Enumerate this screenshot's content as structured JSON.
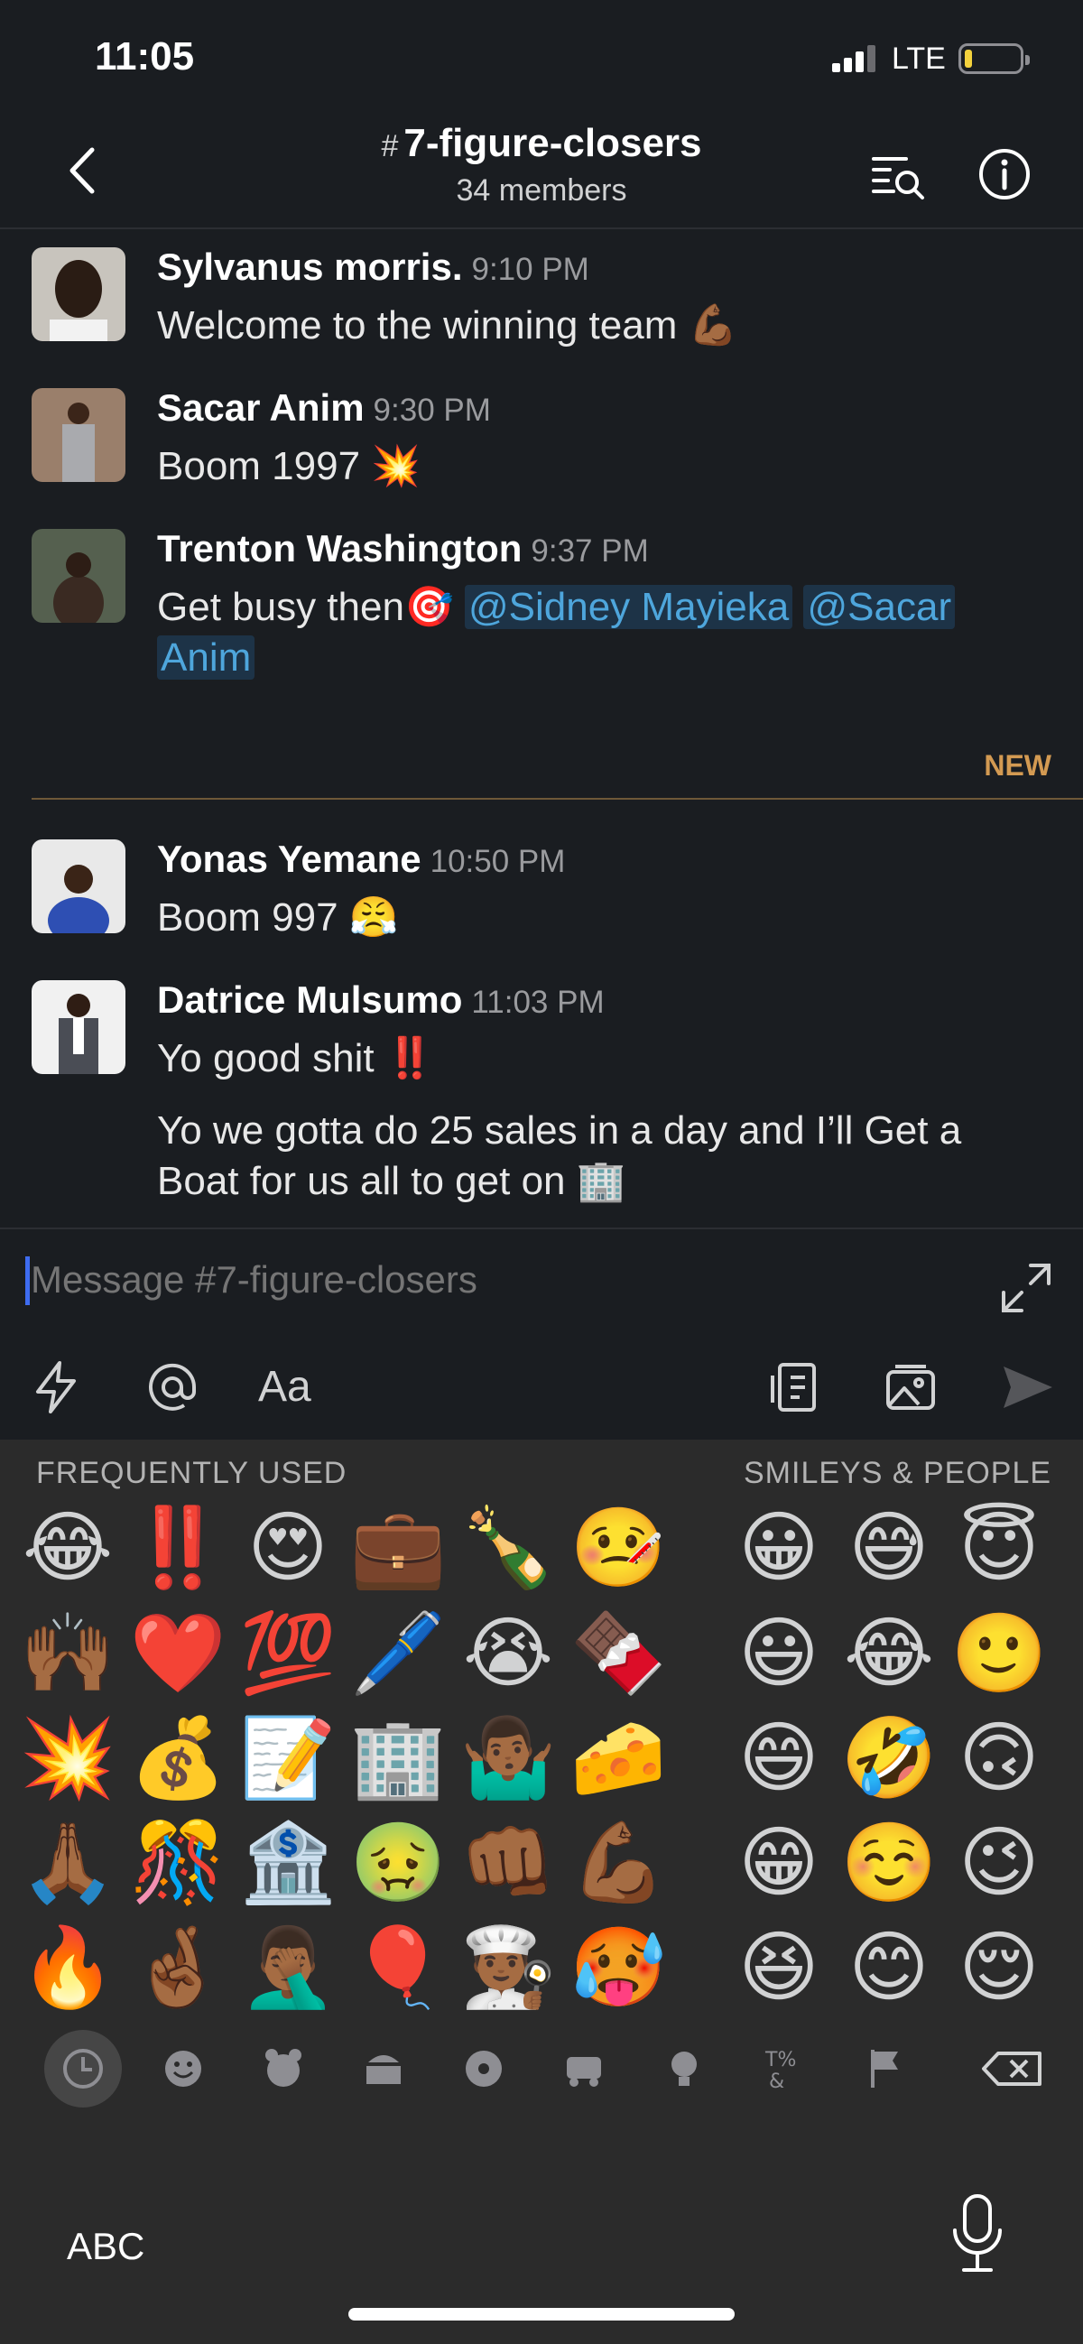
{
  "status_bar": {
    "time": "11:05",
    "network": "LTE"
  },
  "header": {
    "hash": "#",
    "channel": "7-figure-closers",
    "members": "34 members"
  },
  "messages": [
    {
      "author": "Sylvanus morris.",
      "time": "9:10 PM",
      "text": "Welcome to the winning team",
      "emoji": "💪🏾"
    },
    {
      "author": "Sacar Anim",
      "time": "9:30 PM",
      "text": "Boom 1997",
      "emoji": "💥"
    },
    {
      "author": "Trenton Washington",
      "time": "9:37 PM",
      "text": "Get busy then",
      "emoji": "🎯",
      "mention1": "@Sidney Mayieka",
      "mention2a": "@Sacar",
      "mention2b": "Anim"
    },
    {
      "author": "Yonas Yemane",
      "time": "10:50 PM",
      "text": "Boom 997",
      "emoji": "😤"
    },
    {
      "author": "Datrice Mulsumo",
      "time": "11:03 PM",
      "text": "Yo good shit",
      "emoji": "‼️",
      "text2_line1": "Yo we gotta do 25 sales in a day and I’ll Get a",
      "text2_line2": "Boat for us all to get on",
      "emoji2": "🏢"
    }
  ],
  "new_divider": "NEW",
  "composer": {
    "placeholder": "Message #7-figure-closers",
    "format_label": "Aa"
  },
  "keyboard": {
    "section_frequent": "FREQUENTLY USED",
    "section_smileys": "SMILEYS & PEOPLE",
    "frequent": [
      "😂",
      "‼️",
      "😍",
      "💼",
      "🍾",
      "🤒",
      "🙌🏾",
      "❤️",
      "💯",
      "🖊️",
      "😭",
      "🍫",
      "💥",
      "💰",
      "📝",
      "🏢",
      "🤷🏾‍♂️",
      "🧀",
      "🙏🏾",
      "🎊",
      "🏦",
      "🤢",
      "👊🏾",
      "💪🏾",
      "🔥",
      "🤞🏾",
      "🤦🏾‍♂️",
      "🎈",
      "👨🏾‍🍳",
      "🥵"
    ],
    "smileys": [
      "😀",
      "😅",
      "😇",
      "😃",
      "😂",
      "🙂",
      "😄",
      "🤣",
      "🙃",
      "😁",
      "☺️",
      "😉",
      "😆",
      "😊",
      "😌"
    ],
    "abc_label": "ABC"
  },
  "colors": {
    "background": "#1a1d21",
    "keyboard": "#2b2b2b",
    "mention": "#4ea6dc",
    "new_divider": "#d39a52"
  }
}
